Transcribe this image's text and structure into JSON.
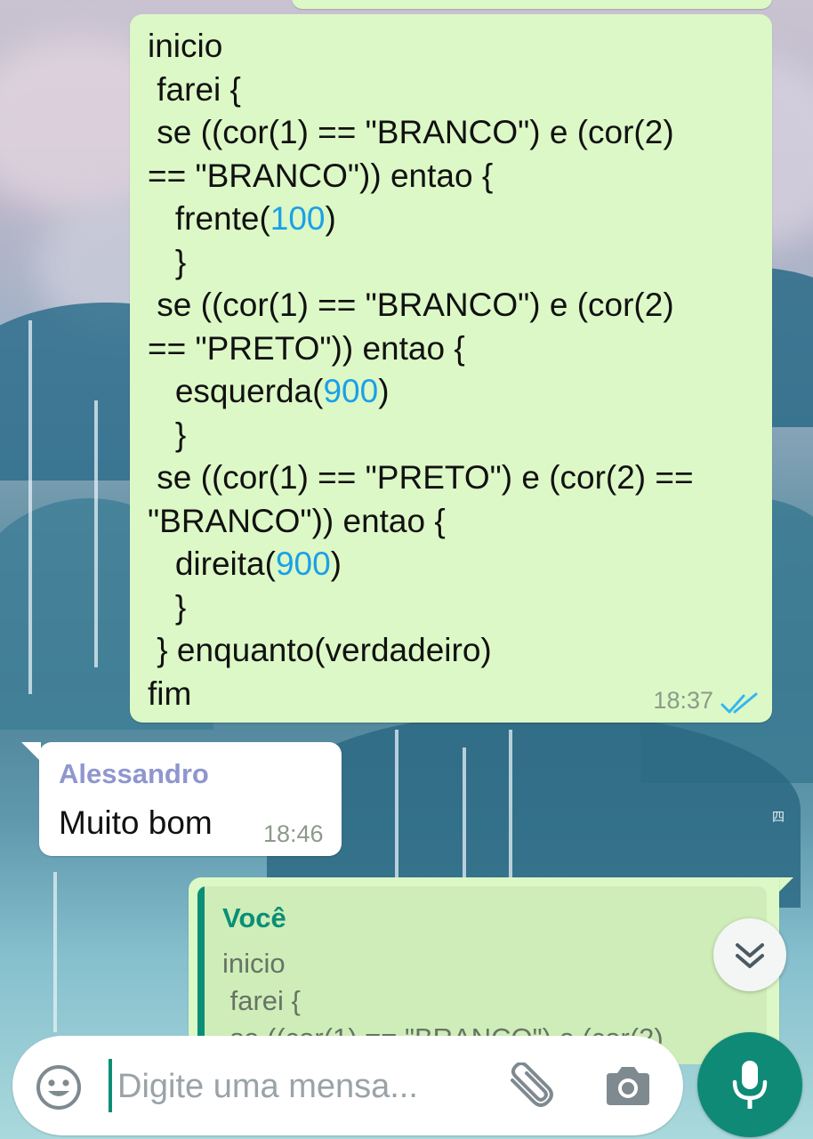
{
  "chat": {
    "sent_code": {
      "lines": [
        [
          "inicio"
        ],
        [
          " farei {"
        ],
        [
          " se ((cor(1) == \"BRANCO\") e (cor(2)"
        ],
        [
          "== \"BRANCO\")) entao {"
        ],
        [
          "   frente(",
          {
            "num": "100"
          },
          ")"
        ],
        [
          "   }"
        ],
        [
          " se ((cor(1) == \"BRANCO\") e (cor(2)"
        ],
        [
          "== \"PRETO\")) entao {"
        ],
        [
          "   esquerda(",
          {
            "num": "900"
          },
          ")"
        ],
        [
          "   }"
        ],
        [
          " se ((cor(1) == \"PRETO\") e (cor(2) =="
        ],
        [
          "\"BRANCO\")) entao {"
        ],
        [
          "   direita(",
          {
            "num": "900"
          },
          ")"
        ],
        [
          "   }"
        ],
        [
          " } enquanto(verdadeiro)"
        ],
        [
          "fim"
        ]
      ],
      "time": "18:37",
      "status_icon": "double-check-read-icon"
    },
    "received": {
      "sender": "Alessandro",
      "text": "Muito bom",
      "time": "18:46"
    },
    "reply_preview": {
      "author": "Você",
      "text_lines": [
        "inicio",
        " farei {",
        " se ((cor(1) == \"BRANCO\") e (cor(2)"
      ]
    }
  },
  "composer": {
    "placeholder": "Digite uma mensa...",
    "value": "",
    "icons": [
      "emoji-icon",
      "attach-paperclip-icon",
      "camera-icon",
      "microphone-icon"
    ]
  },
  "scroll_button_icon": "double-chevron-down-icon",
  "colors": {
    "outgoing_bubble": "#dcf8c6",
    "incoming_bubble": "#ffffff",
    "accent": "#0a8f76",
    "sender_name": "#8f96cf",
    "number": "#1aa0e8",
    "read_ticks": "#34b7f1"
  }
}
